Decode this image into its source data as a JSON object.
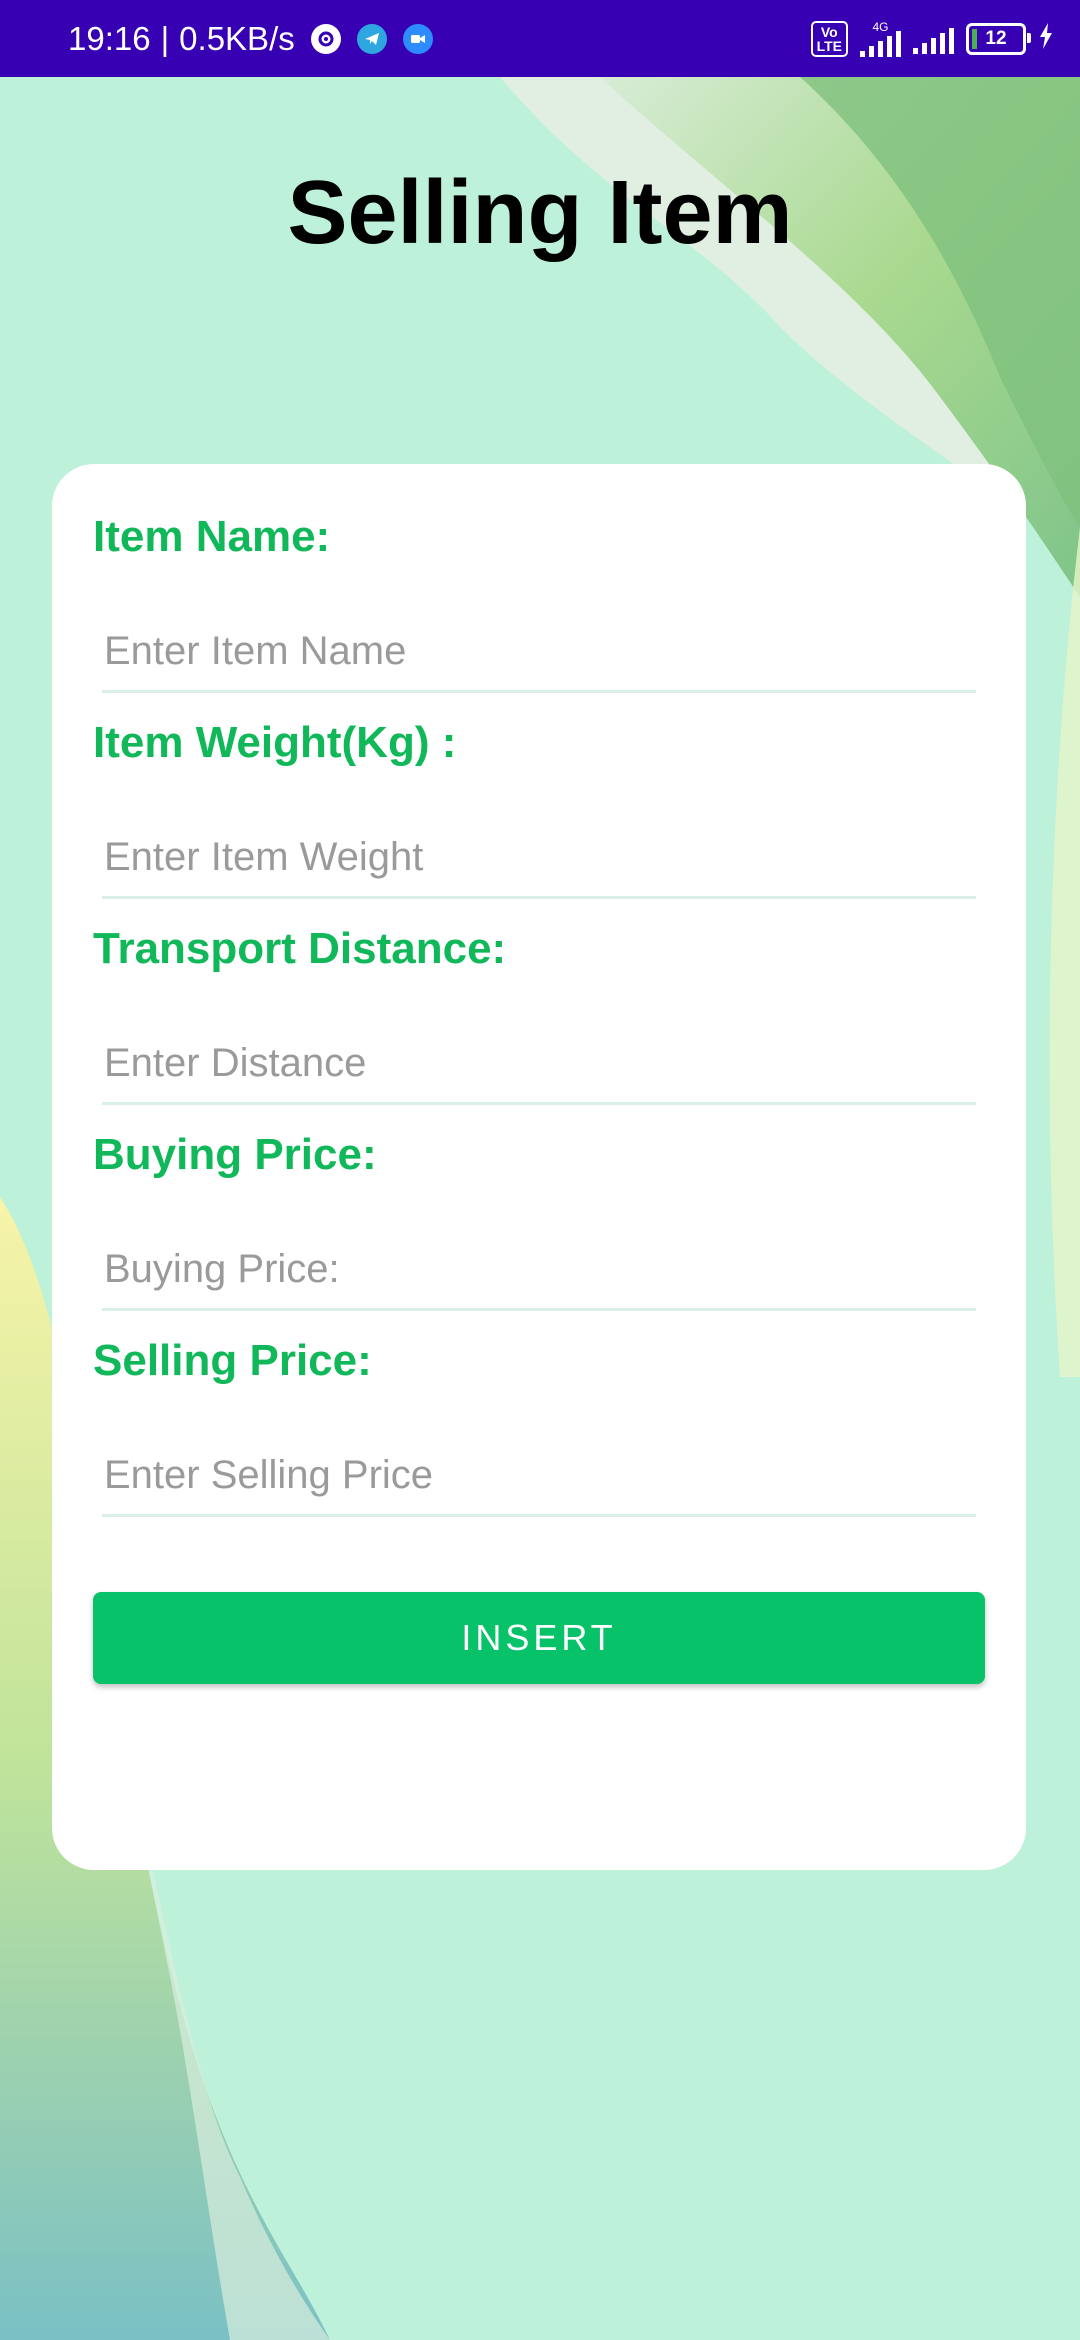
{
  "status_bar": {
    "time": "19:16",
    "separator": "|",
    "speed": "0.5KB/s",
    "volte": "Vo\nLTE",
    "network": "4G",
    "battery": "12",
    "icons": [
      "settings-app-icon",
      "telegram-icon",
      "video-app-icon",
      "signal-icon",
      "signal-icon-2",
      "battery-icon",
      "charging-icon"
    ]
  },
  "page": {
    "title": "Selling Item"
  },
  "form": {
    "fields": [
      {
        "label": "Item Name:",
        "placeholder": "Enter Item Name"
      },
      {
        "label": "Item Weight(Kg) :",
        "placeholder": "Enter Item Weight"
      },
      {
        "label": "Transport Distance:",
        "placeholder": "Enter Distance"
      },
      {
        "label": "Buying Price:",
        "placeholder": "Buying Price:"
      },
      {
        "label": "Selling Price:",
        "placeholder": "Enter Selling Price"
      }
    ],
    "submit_label": "INSERT"
  },
  "colors": {
    "status_bar": "#3700b3",
    "background": "#bdf1da",
    "label_green": "#10b85a",
    "button_green": "#08c26a"
  }
}
